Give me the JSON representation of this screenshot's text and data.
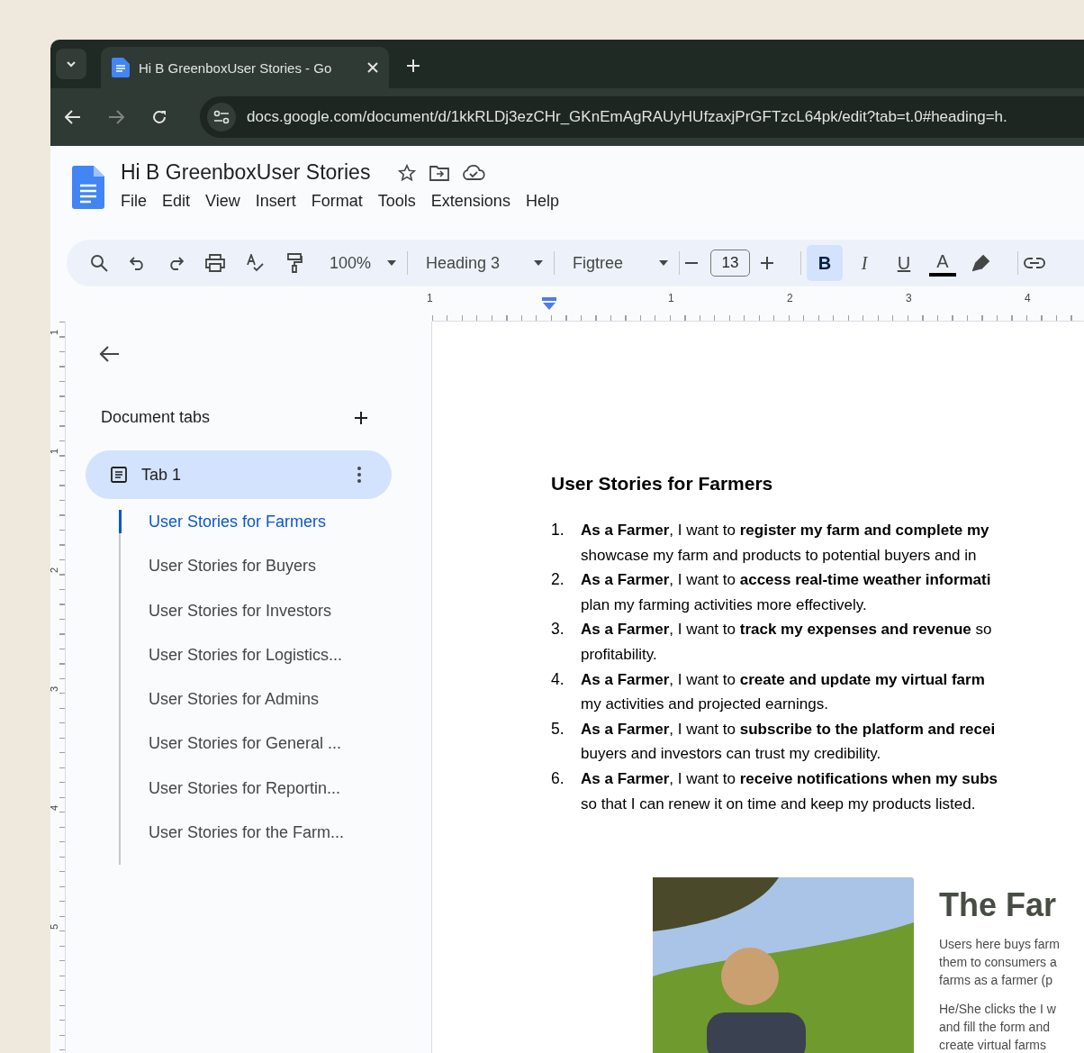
{
  "browser": {
    "tab_title": "Hi B GreenboxUser Stories - Go",
    "url": "docs.google.com/document/d/1kkRLDj3ezCHr_GKnEmAgRAUyHUfzaxjPrGFTzcL64pk/edit?tab=t.0#heading=h."
  },
  "document": {
    "title": "Hi B GreenboxUser Stories",
    "menu": [
      "File",
      "Edit",
      "View",
      "Insert",
      "Format",
      "Tools",
      "Extensions",
      "Help"
    ]
  },
  "toolbar": {
    "zoom": "100%",
    "style": "Heading 3",
    "font": "Figtree",
    "font_size": "13",
    "format_buttons": [
      {
        "kind": "bold",
        "label": "B",
        "selected": true
      },
      {
        "kind": "italic",
        "label": "I",
        "selected": false
      },
      {
        "kind": "underline",
        "label": "U",
        "selected": false
      }
    ],
    "text_color_label": "A"
  },
  "ruler": {
    "labels": [
      "1",
      "1",
      "2",
      "3",
      "4"
    ],
    "vertical_labels": [
      "1",
      "1",
      "2",
      "3",
      "4",
      "5"
    ]
  },
  "sidebar": {
    "heading": "Document tabs",
    "tabs": [
      {
        "label": "Tab 1",
        "selected": true
      }
    ],
    "outline": [
      {
        "label": "User Stories for Farmers",
        "selected": true
      },
      {
        "label": "User Stories for Buyers",
        "selected": false
      },
      {
        "label": "User Stories for Investors",
        "selected": false
      },
      {
        "label": "User Stories for Logistics...",
        "selected": false
      },
      {
        "label": "User Stories for Admins",
        "selected": false
      },
      {
        "label": "User Stories for General ...",
        "selected": false
      },
      {
        "label": "User Stories for Reportin...",
        "selected": false
      },
      {
        "label": "User Stories for the Farm...",
        "selected": false
      }
    ]
  },
  "page": {
    "heading": "User Stories for Farmers",
    "items": [
      {
        "number": "1.",
        "lines": [
          "**As a Farmer**, I want to **register my farm and complete my**",
          "showcase my farm and products to potential buyers and in"
        ]
      },
      {
        "number": "2.",
        "lines": [
          "**As a Farmer**, I want to **access real-time weather informati**",
          "plan my farming activities more effectively."
        ]
      },
      {
        "number": "3.",
        "lines": [
          "**As a Farmer**, I want to **track my expenses and revenue** so",
          "profitability."
        ]
      },
      {
        "number": "4.",
        "lines": [
          "**As a Farmer**, I want to **create and update my virtual farm**",
          "my activities and projected earnings."
        ]
      },
      {
        "number": "5.",
        "lines": [
          "**As a Farmer**, I want to **subscribe to the platform and recei**",
          "buyers and investors can trust my credibility."
        ]
      },
      {
        "number": "6.",
        "lines": [
          "**As a Farmer**, I want to **receive notifications when my subs**",
          "so that I can renew it on time and keep my products listed."
        ]
      }
    ],
    "embedded_screenshot": {
      "title": "The Far",
      "paragraphs": [
        [
          "Users here buys farm",
          "them to consumers a",
          "farms as a farmer (p"
        ],
        [
          "He/She clicks the I w",
          "and fill the form and",
          "create virtual farms"
        ]
      ]
    }
  }
}
